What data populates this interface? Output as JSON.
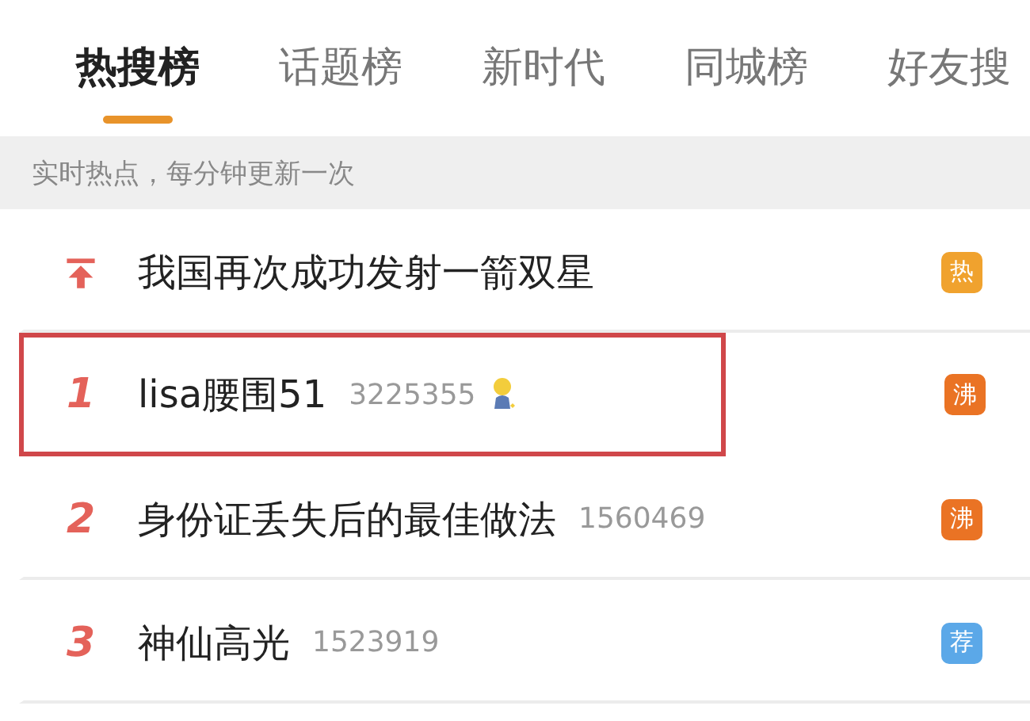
{
  "tabs": [
    {
      "label": "热搜榜",
      "selected": true
    },
    {
      "label": "话题榜",
      "selected": false
    },
    {
      "label": "新时代",
      "selected": false
    },
    {
      "label": "同城榜",
      "selected": false
    },
    {
      "label": "好友搜",
      "selected": false
    }
  ],
  "notice": "实时热点，每分钟更新一次",
  "rows": [
    {
      "kind": "pinned",
      "title": "我国再次成功发射一箭双星",
      "badge": {
        "text": "热",
        "color": "#f0a22e"
      },
      "highlighted": false,
      "emoji": false
    },
    {
      "kind": "ranked",
      "rank": "1",
      "title": "lisa腰围51",
      "count": "3225355",
      "badge": {
        "text": "沸",
        "color": "#ea7324"
      },
      "highlighted": true,
      "emoji": true
    },
    {
      "kind": "ranked",
      "rank": "2",
      "title": "身份证丢失后的最佳做法",
      "count": "1560469",
      "badge": {
        "text": "沸",
        "color": "#ea7324"
      },
      "highlighted": false,
      "emoji": false
    },
    {
      "kind": "ranked",
      "rank": "3",
      "title": "神仙高光",
      "count": "1523919",
      "badge": {
        "text": "荐",
        "color": "#5ba8e8"
      },
      "highlighted": false,
      "emoji": false
    }
  ]
}
